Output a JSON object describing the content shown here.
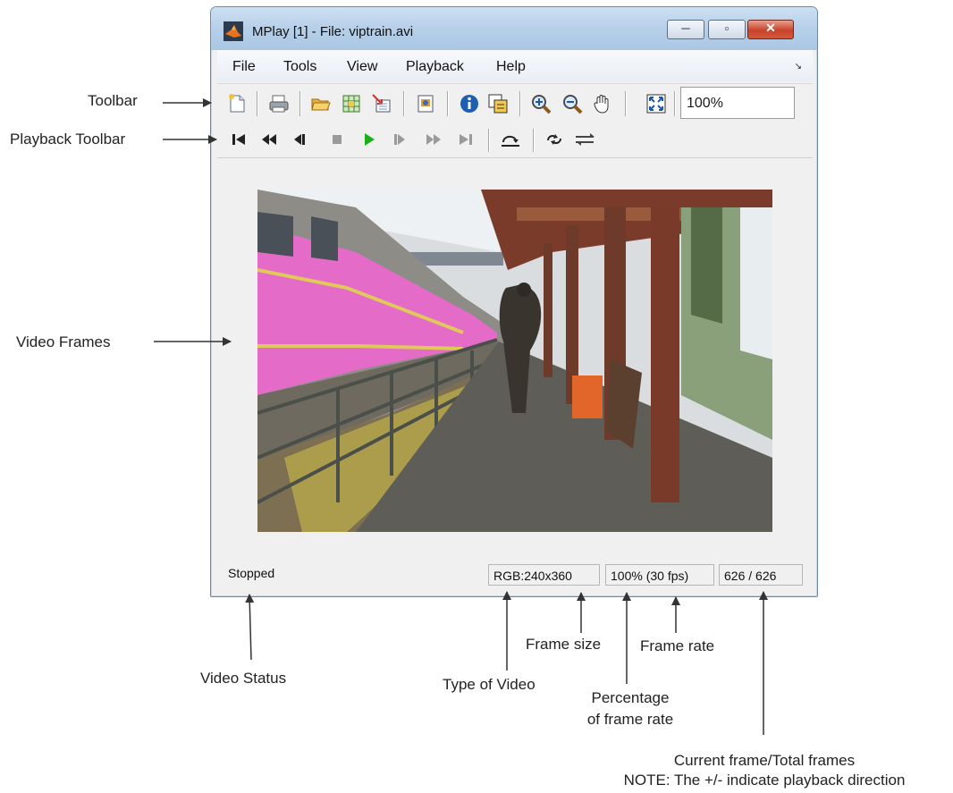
{
  "window": {
    "title": "MPlay [1] - File: viptrain.avi",
    "controls": {
      "minimize": "─",
      "maximize": "▫",
      "close": "✕"
    }
  },
  "menu": {
    "items": [
      "File",
      "Tools",
      "View",
      "Playback",
      "Help"
    ],
    "corner_glyph": "↘"
  },
  "toolbar": {
    "icons": [
      "new-icon",
      "print-icon",
      "open-icon",
      "import-icon",
      "export-icon",
      "config-icon",
      "info-icon",
      "pixel-region-icon",
      "zoom-in-icon",
      "zoom-out-icon",
      "pan-icon",
      "fit-to-window-icon"
    ],
    "zoom_value": "100%"
  },
  "playback_toolbar": {
    "icons": [
      "go-to-first-icon",
      "rewind-icon",
      "step-back-icon",
      "stop-icon",
      "play-icon",
      "step-forward-icon",
      "fast-forward-icon",
      "go-to-last-icon",
      "jump-to-icon",
      "repeat-icon",
      "forward-backward-icon"
    ]
  },
  "status": {
    "state": "Stopped",
    "video_type": "RGB:240x360",
    "frame_rate": "100% (30 fps)",
    "frame_counter": "626 / 626"
  },
  "annotations": {
    "toolbar": "Toolbar",
    "playback_toolbar": "Playback Toolbar",
    "video_frames": "Video Frames",
    "video_status": "Video Status",
    "type_of_video": "Type of Video",
    "frame_size": "Frame size",
    "frame_rate": "Frame rate",
    "percentage_line1": "Percentage",
    "percentage_line2": "of frame rate",
    "current_frame_line1": "Current frame/Total frames",
    "current_frame_line2": "NOTE: The +/- indicate playback direction"
  },
  "colors": {
    "titlebar": "#b8d1ea",
    "close_button": "#c8432b",
    "play_green": "#19b019"
  }
}
